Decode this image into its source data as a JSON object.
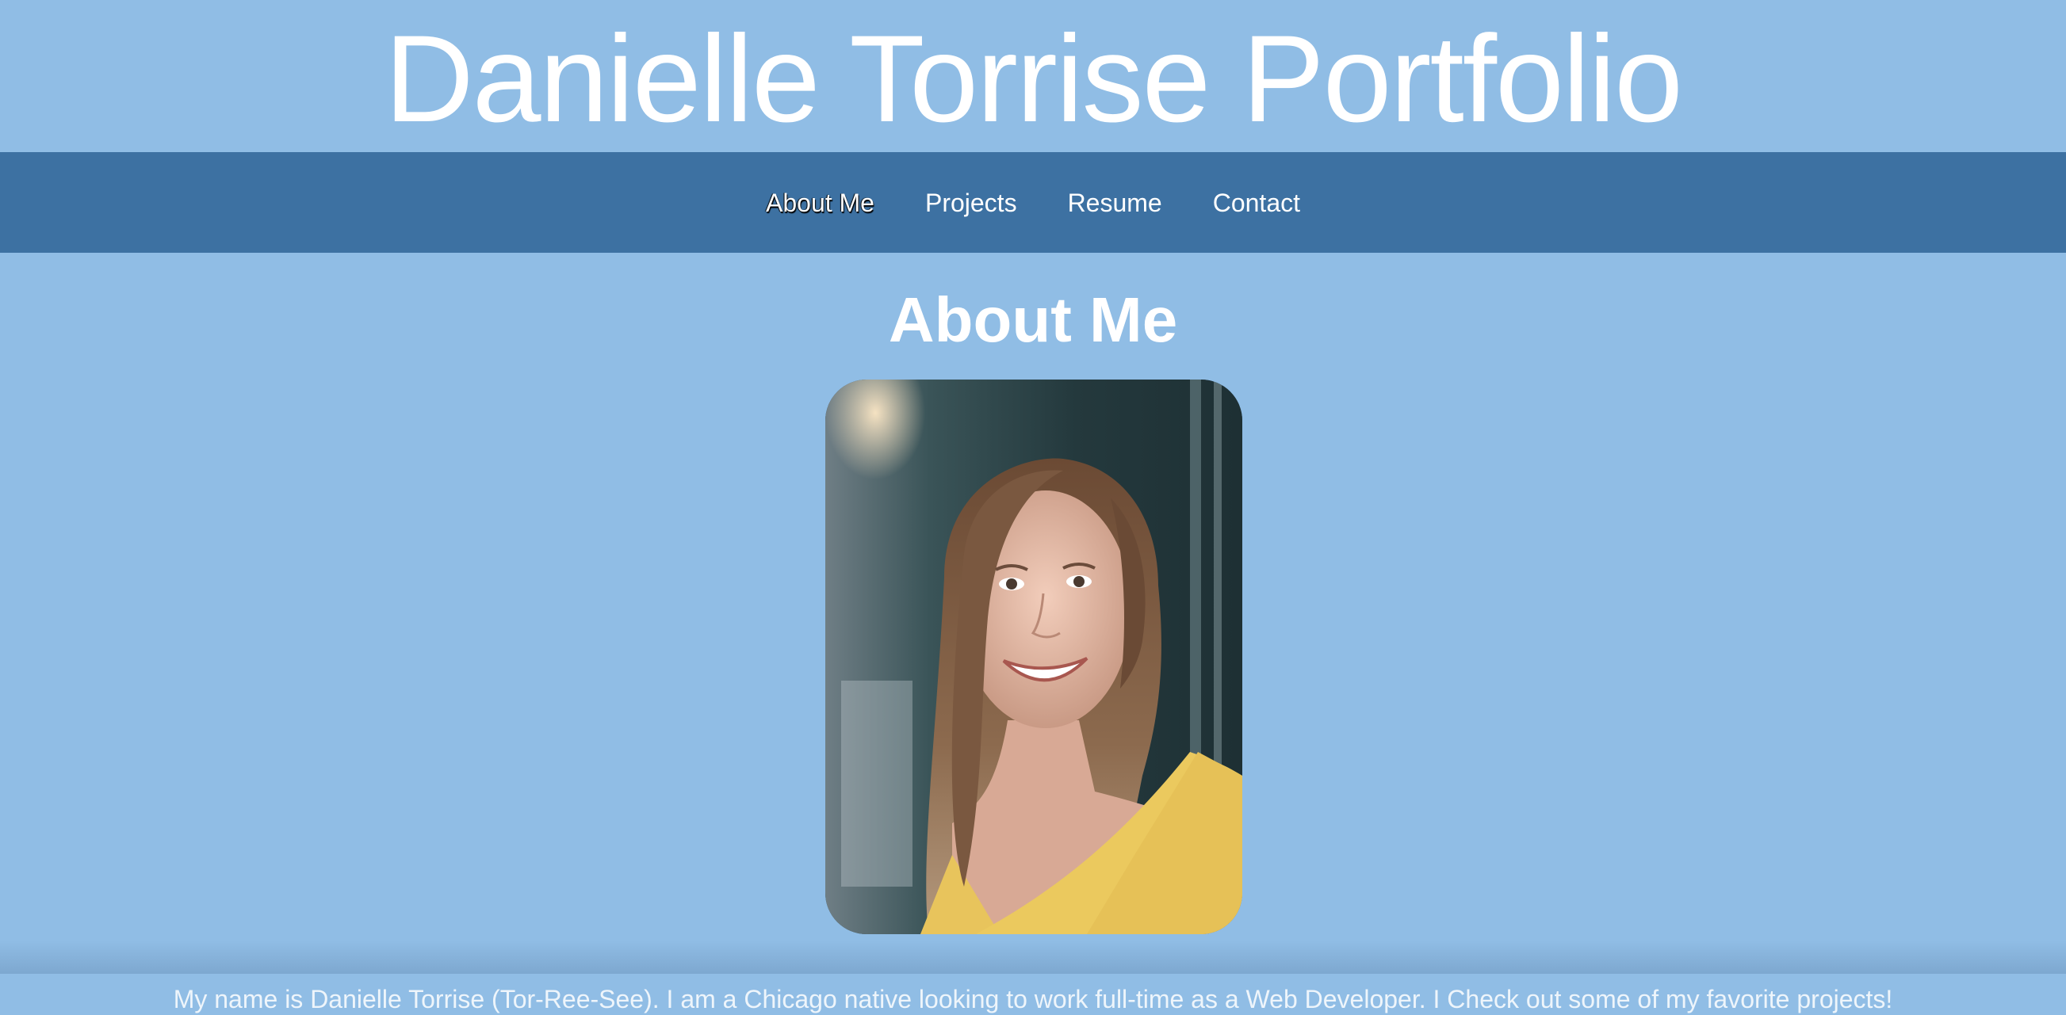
{
  "header": {
    "title": "Danielle Torrise Portfolio"
  },
  "nav": {
    "items": [
      {
        "label": "About Me",
        "active": true
      },
      {
        "label": "Projects",
        "active": false
      },
      {
        "label": "Resume",
        "active": false
      },
      {
        "label": "Contact",
        "active": false
      }
    ]
  },
  "about": {
    "heading": "About Me",
    "photo": "portrait-photo",
    "bio_partial": "My name is Danielle Torrise (Tor-Ree-See). I am a Chicago native looking to work full-time as a Web Developer. I Check out some of my favorite projects!"
  },
  "colors": {
    "page_background": "#90bde5",
    "nav_background": "#3d71a2",
    "text": "#ffffff"
  }
}
